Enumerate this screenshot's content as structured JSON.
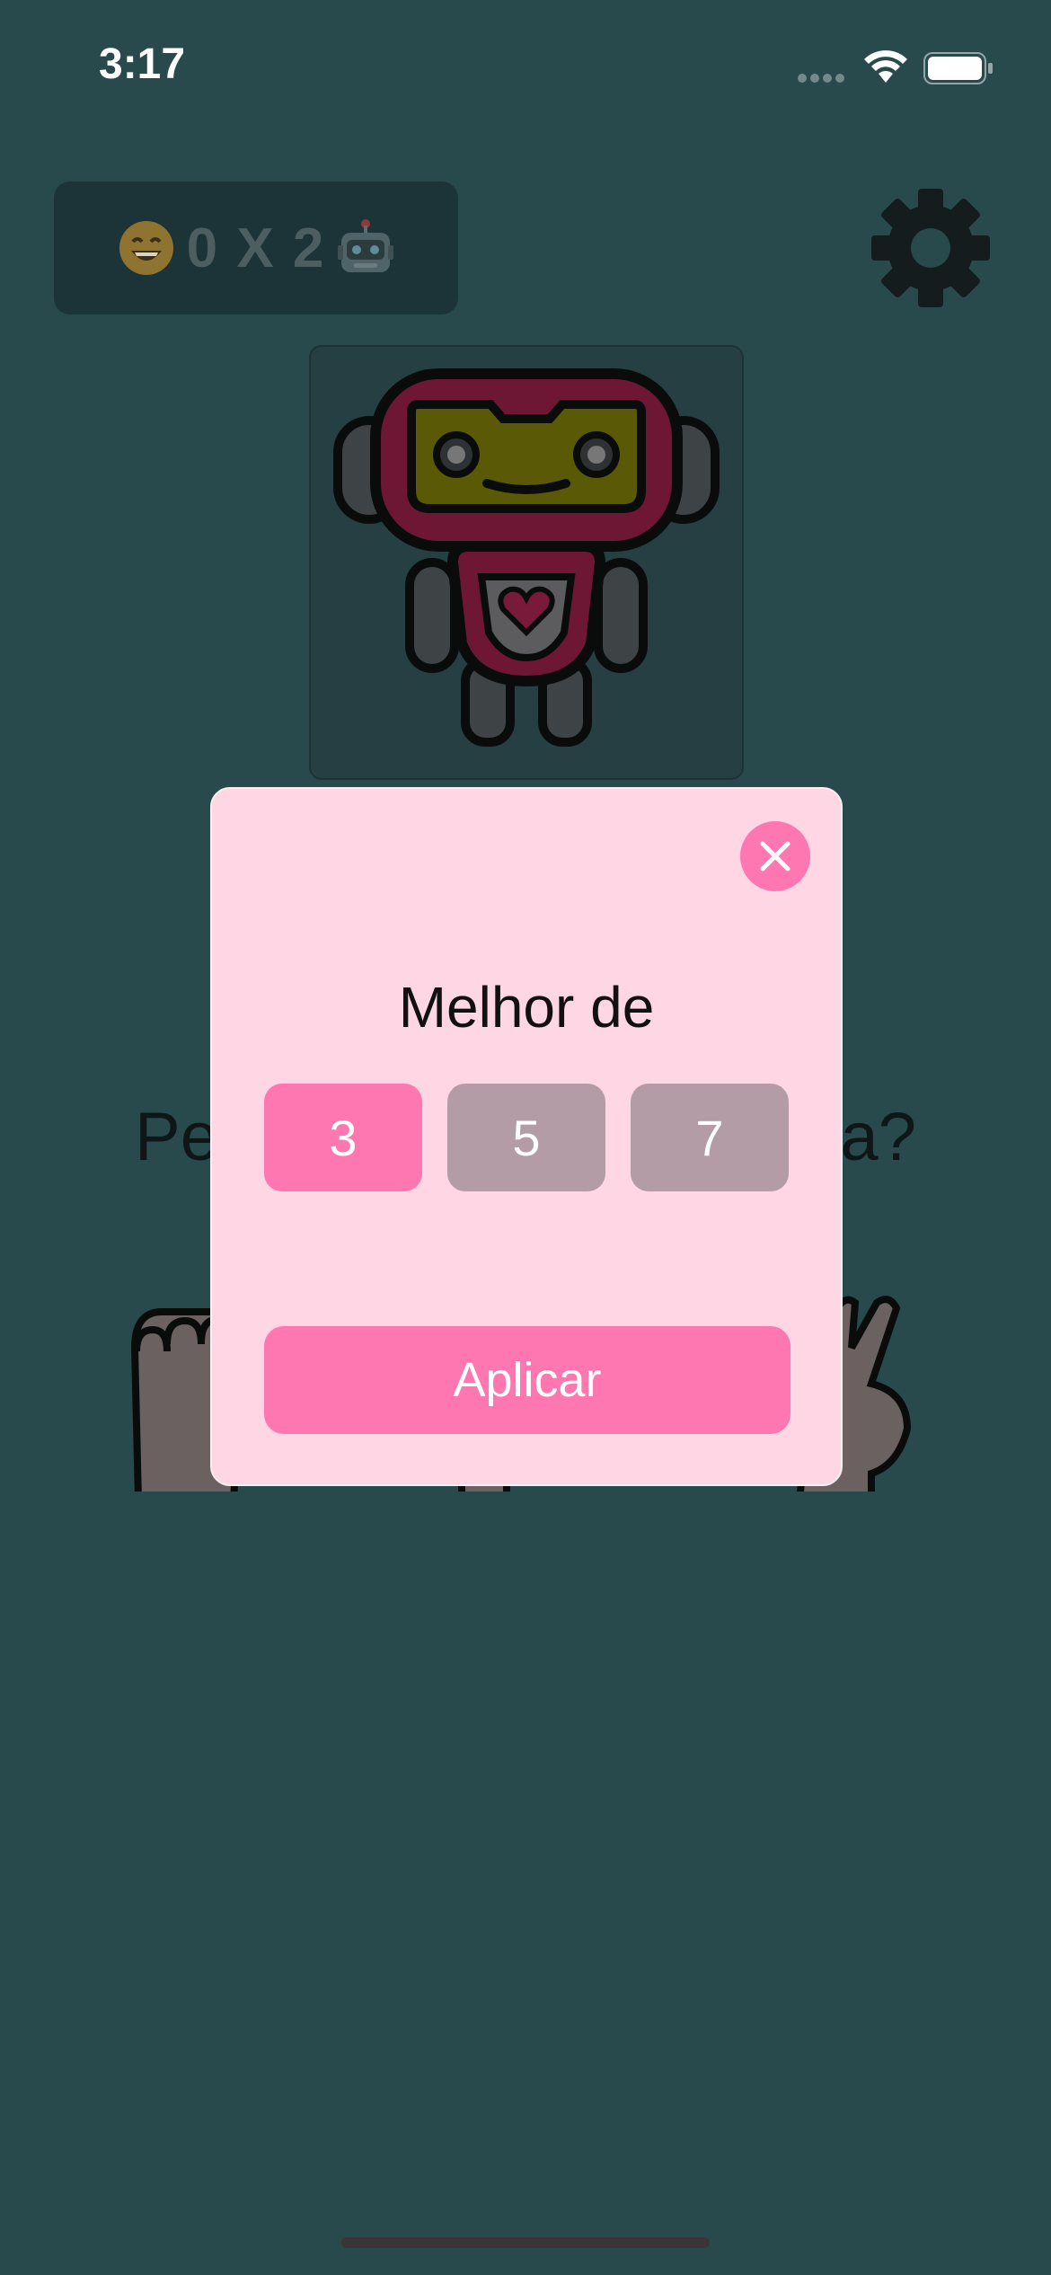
{
  "status_bar": {
    "time": "3:17",
    "icons": [
      "cellular-signal-icon",
      "wifi-icon",
      "battery-icon"
    ]
  },
  "scoreboard": {
    "player_icon": "grinning-face-emoji",
    "score_text": "0 X 2",
    "opponent_icon": "robot-face-emoji"
  },
  "settings_icon": "gear-icon",
  "opponent_avatar": "robot-avatar",
  "question": {
    "visible_left": "Pe",
    "visible_right": "a?"
  },
  "hand_choices": [
    "rock-hand-icon",
    "paper-hand-icon",
    "scissors-hand-icon"
  ],
  "modal": {
    "title": "Melhor de",
    "options": [
      {
        "label": "3",
        "selected": true
      },
      {
        "label": "5",
        "selected": false
      },
      {
        "label": "7",
        "selected": false
      }
    ],
    "apply_label": "Aplicar",
    "close_icon": "close-icon"
  },
  "colors": {
    "background": "#294A4D",
    "modal_background": "#FFD6E4",
    "accent": "#FF77B0",
    "option_inactive": "#B39CA5"
  }
}
